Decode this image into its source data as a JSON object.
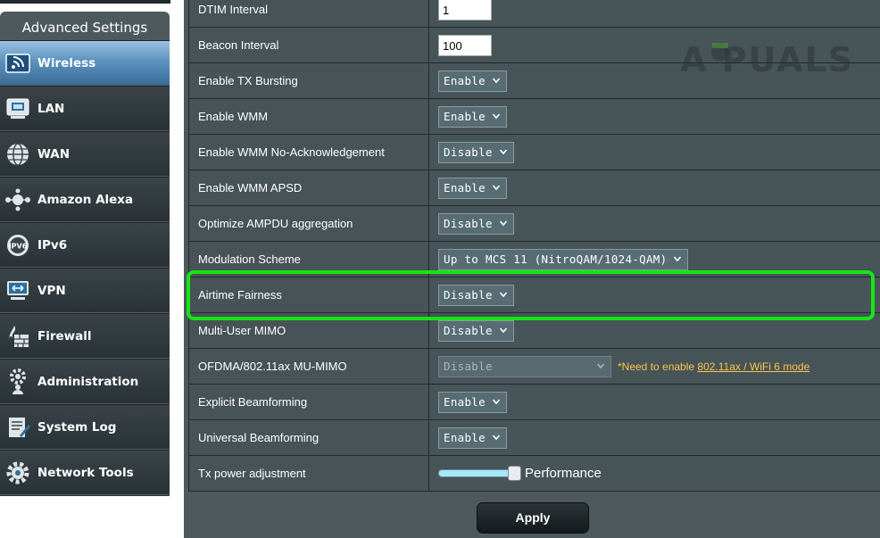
{
  "sidebar": {
    "title": "Advanced Settings",
    "items": [
      {
        "label": "Wireless",
        "icon": "wireless-icon",
        "active": true
      },
      {
        "label": "LAN",
        "icon": "lan-icon"
      },
      {
        "label": "WAN",
        "icon": "globe-icon"
      },
      {
        "label": "Amazon Alexa",
        "icon": "alexa-icon"
      },
      {
        "label": "IPv6",
        "icon": "ipv6-icon"
      },
      {
        "label": "VPN",
        "icon": "vpn-icon"
      },
      {
        "label": "Firewall",
        "icon": "firewall-icon"
      },
      {
        "label": "Administration",
        "icon": "gear-person-icon"
      },
      {
        "label": "System Log",
        "icon": "log-icon"
      },
      {
        "label": "Network Tools",
        "icon": "gear-icon"
      }
    ]
  },
  "settings": {
    "rows": [
      {
        "label": "DTIM Interval",
        "control": "text",
        "value": "1"
      },
      {
        "label": "Beacon Interval",
        "control": "text",
        "value": "100"
      },
      {
        "label": "Enable TX Bursting",
        "control": "select",
        "value": "Enable"
      },
      {
        "label": "Enable WMM",
        "control": "select",
        "value": "Enable"
      },
      {
        "label": "Enable WMM No-Acknowledgement",
        "control": "select",
        "value": "Disable"
      },
      {
        "label": "Enable WMM APSD",
        "control": "select",
        "value": "Enable"
      },
      {
        "label": "Optimize AMPDU aggregation",
        "control": "select",
        "value": "Disable"
      },
      {
        "label": "Modulation Scheme",
        "control": "select",
        "value": "Up to MCS 11 (NitroQAM/1024-QAM)"
      },
      {
        "label": "Airtime Fairness",
        "control": "select",
        "value": "Disable",
        "highlighted": true
      },
      {
        "label": "Multi-User MIMO",
        "control": "select",
        "value": "Disable"
      },
      {
        "label": "OFDMA/802.11ax MU-MIMO",
        "control": "select",
        "value": "Disable",
        "disabled": true,
        "note": "*Need to enable ",
        "note_link": "802.11ax / WiFi 6 mode"
      },
      {
        "label": "Explicit Beamforming",
        "control": "select",
        "value": "Enable"
      },
      {
        "label": "Universal Beamforming",
        "control": "select",
        "value": "Enable"
      },
      {
        "label": "Tx power adjustment",
        "control": "slider",
        "value": "Performance",
        "level": 1.0
      }
    ]
  },
  "apply_label": "Apply",
  "watermark": "A PUALS",
  "colors": {
    "highlight": "#14e614",
    "note": "#fcc44a",
    "panel": "#4d595d",
    "active_item": "#5d93bf"
  }
}
